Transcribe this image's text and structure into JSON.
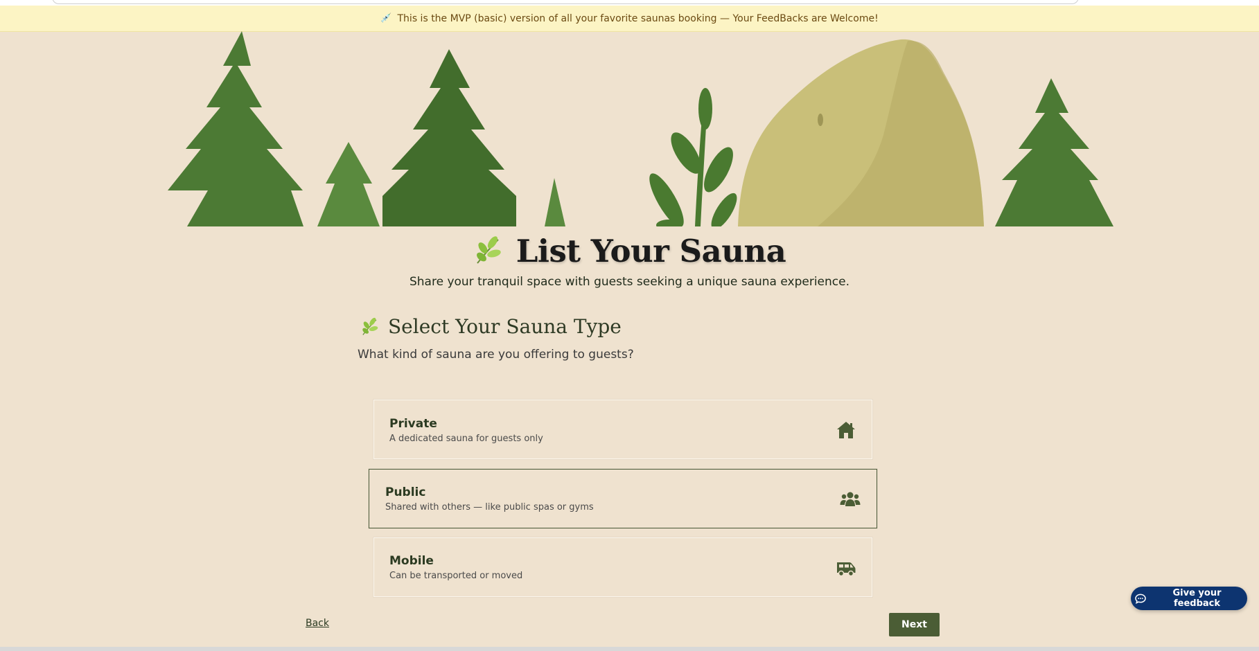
{
  "banner": {
    "icon": "syringe-icon",
    "text": "This is the MVP (basic) version of all your favorite saunas booking — Your FeedBacks are Welcome!"
  },
  "hero": {
    "title": "List Your Sauna",
    "subtitle": "Share your tranquil space with guests seeking a unique sauna experience.",
    "icon": "herb-icon"
  },
  "section": {
    "title": "Select Your Sauna Type",
    "subtitle": "What kind of sauna are you offering to guests?",
    "icon": "herb-icon"
  },
  "options": [
    {
      "title": "Private",
      "description": "A dedicated sauna for guests only",
      "icon": "house-icon",
      "selected": false
    },
    {
      "title": "Public",
      "description": "Shared with others — like public spas or gyms",
      "icon": "people-group-icon",
      "selected": true
    },
    {
      "title": "Mobile",
      "description": "Can be transported or moved",
      "icon": "van-icon",
      "selected": false
    }
  ],
  "nav": {
    "back_label": "Back",
    "next_label": "Next"
  },
  "feedback": {
    "label": "Give your feedback",
    "icon": "chat-bubble-icon"
  },
  "colors": {
    "background": "#efe2cf",
    "banner": "#fcf4c4",
    "accent_green": "#4b5d35",
    "feedback_blue": "#0d3470"
  }
}
